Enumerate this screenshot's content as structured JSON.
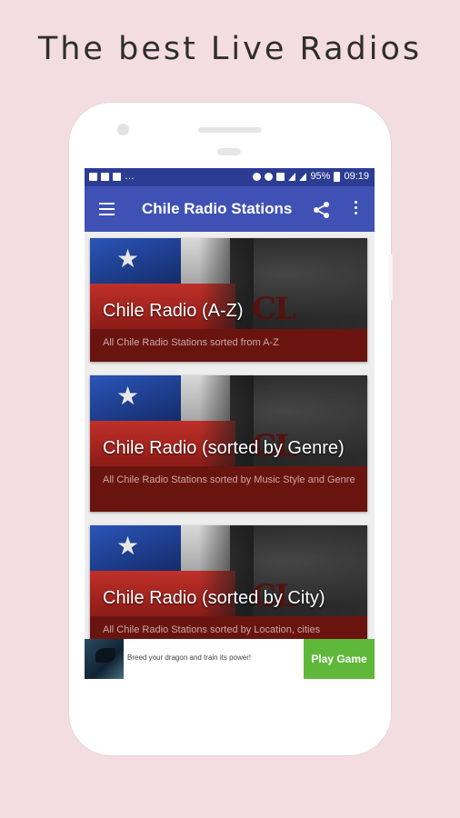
{
  "promo": {
    "headline": "The best Live Radios"
  },
  "status_bar": {
    "battery": "95%",
    "time": "09:19"
  },
  "app_bar": {
    "title": "Chile Radio Stations"
  },
  "cards": [
    {
      "title": "Chile Radio (A-Z)",
      "description": "All Chile Radio Stations sorted from A-Z",
      "image_text": "CL"
    },
    {
      "title": "Chile Radio (sorted by Genre)",
      "description": "All Chile Radio Stations sorted by Music Style and Genre",
      "image_text": "CL"
    },
    {
      "title": "Chile Radio (sorted by City)",
      "description": "All Chile Radio Stations sorted by Location, cities",
      "image_text": "CL"
    }
  ],
  "ad": {
    "text": "Breed your dragon and train its power!",
    "button": "Play Game"
  },
  "colors": {
    "background": "#f3dde1",
    "status_bar": "#2c3c93",
    "app_bar": "#3f51b5",
    "card": "#6a1410",
    "ad_button": "#5fb83a"
  },
  "icons": [
    "menu-icon",
    "share-icon",
    "more-vert-icon",
    "star-icon"
  ]
}
